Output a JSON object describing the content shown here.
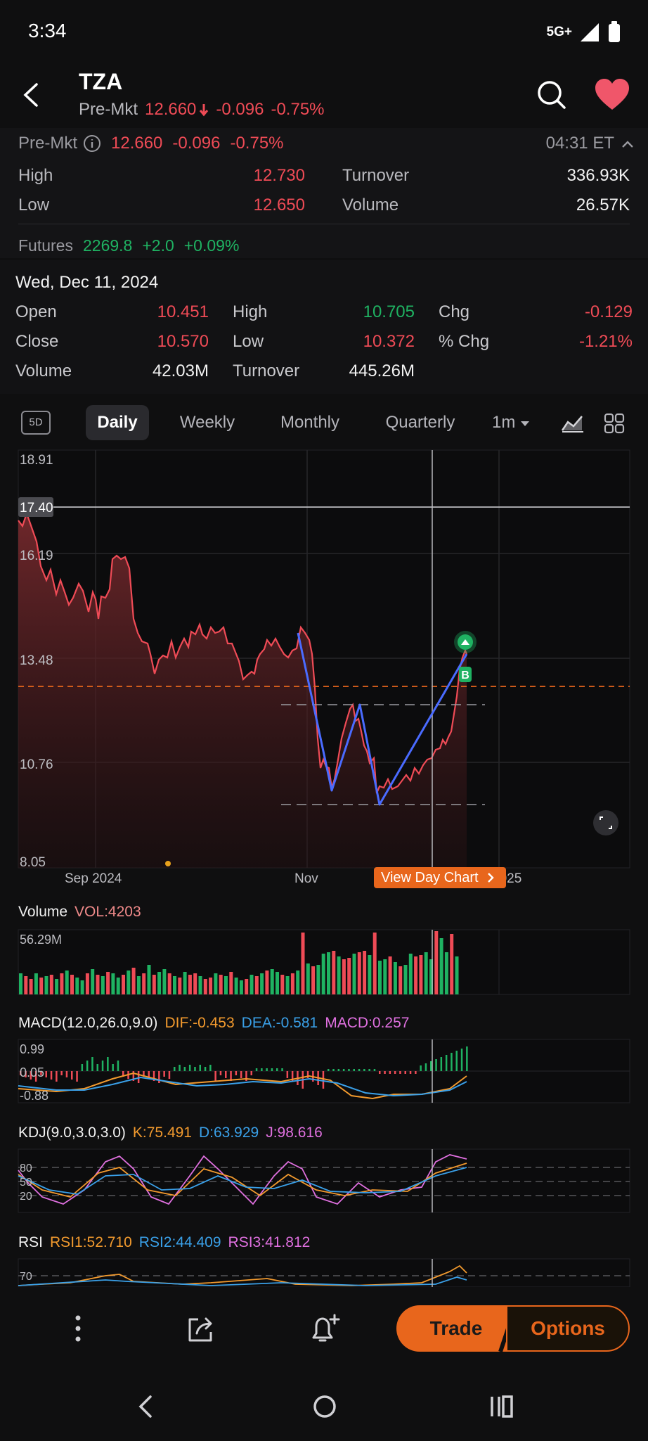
{
  "status": {
    "time": "3:34",
    "network": "5G+"
  },
  "header": {
    "ticker": "TZA",
    "premkt_label": "Pre-Mkt",
    "premkt_price": "12.660",
    "premkt_change": "-0.096",
    "premkt_pct": "-0.75%"
  },
  "quote": {
    "premkt_label": "Pre-Mkt",
    "price": "12.660",
    "change": "-0.096",
    "pct": "-0.75%",
    "time": "04:31 ET",
    "high_label": "High",
    "high": "12.730",
    "low_label": "Low",
    "low": "12.650",
    "turnover_label": "Turnover",
    "turnover": "336.93K",
    "volume_label": "Volume",
    "volume": "26.57K",
    "futures_label": "Futures",
    "futures_value": "2269.8",
    "futures_change": "+2.0",
    "futures_pct": "+0.09%"
  },
  "day": {
    "date": "Wed, Dec 11, 2024",
    "open_label": "Open",
    "open": "10.451",
    "high_label": "High",
    "high": "10.705",
    "chg_label": "Chg",
    "chg": "-0.129",
    "close_label": "Close",
    "close": "10.570",
    "low_label": "Low",
    "low": "10.372",
    "pct_label": "% Chg",
    "pct": "-1.21%",
    "volume_label": "Volume",
    "volume": "42.03M",
    "turnover_label": "Turnover",
    "turnover": "445.26M"
  },
  "tabs": {
    "five_day": "5D",
    "daily": "Daily",
    "weekly": "Weekly",
    "monthly": "Monthly",
    "quarterly": "Quarterly",
    "interval": "1m"
  },
  "chart": {
    "y_ticks": [
      "18.91",
      "16.19",
      "13.48",
      "10.76",
      "8.05"
    ],
    "crosshair_value": "17.40",
    "x_labels": [
      "Sep 2024",
      "Nov",
      "2025"
    ],
    "view_day_label": "View Day Chart",
    "marker_b": "B"
  },
  "volume": {
    "title": "Volume",
    "vol_label": "VOL:4203",
    "max_label": "56.29M"
  },
  "macd": {
    "title": "MACD(12.0,26.0,9.0)",
    "dif": "DIF:-0.453",
    "dea": "DEA:-0.581",
    "macd": "MACD:0.257",
    "ticks": [
      "0.99",
      "0.05",
      "-0.88"
    ]
  },
  "kdj": {
    "title": "KDJ(9.0,3.0,3.0)",
    "k": "K:75.491",
    "d": "D:63.929",
    "j": "J:98.616",
    "ticks": [
      "80",
      "50",
      "20"
    ]
  },
  "rsi": {
    "title": "RSI",
    "rsi1": "RSI1:52.710",
    "rsi2": "RSI2:44.409",
    "rsi3": "RSI3:41.812",
    "tick": "70"
  },
  "actions": {
    "trade": "Trade",
    "options": "Options"
  },
  "colors": {
    "up": "#1fb262",
    "down": "#ef4b56",
    "accent": "#e8661c",
    "pattern": "#4a6bff"
  }
}
